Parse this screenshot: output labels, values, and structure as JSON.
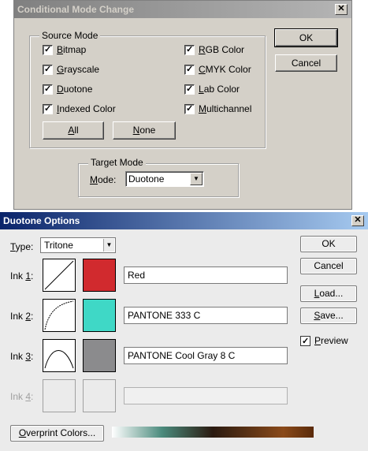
{
  "dialog1": {
    "title": "Conditional Mode Change",
    "close_glyph": "✕",
    "source_mode": {
      "label": "Source Mode",
      "left": [
        {
          "pre": "",
          "ul": "B",
          "post": "itmap",
          "checked": true
        },
        {
          "pre": "",
          "ul": "G",
          "post": "rayscale",
          "checked": true
        },
        {
          "pre": "",
          "ul": "D",
          "post": "uotone",
          "checked": true
        },
        {
          "pre": "",
          "ul": "I",
          "post": "ndexed Color",
          "checked": true
        }
      ],
      "right": [
        {
          "pre": "",
          "ul": "R",
          "post": "GB Color",
          "checked": true
        },
        {
          "pre": "",
          "ul": "C",
          "post": "MYK Color",
          "checked": true
        },
        {
          "pre": "",
          "ul": "L",
          "post": "ab Color",
          "checked": true
        },
        {
          "pre": "",
          "ul": "M",
          "post": "ultichannel",
          "checked": true
        }
      ],
      "all_pre": "",
      "all_ul": "A",
      "all_post": "ll",
      "none_pre": "",
      "none_ul": "N",
      "none_post": "one"
    },
    "target_mode": {
      "label": "Target Mode",
      "mode_pre": "",
      "mode_ul": "M",
      "mode_post": "ode:",
      "mode_value": "Duotone"
    },
    "ok_label": "OK",
    "cancel_label": "Cancel"
  },
  "dialog2": {
    "title": "Duotone Options",
    "close_glyph": "✕",
    "type_pre": "",
    "type_ul": "T",
    "type_post": "ype:",
    "type_value": "Tritone",
    "inks": [
      {
        "pre": "Ink ",
        "ul": "1",
        "post": ":",
        "name": "Red",
        "color": "#d12a2e",
        "curve": "linear",
        "enabled": true
      },
      {
        "pre": "Ink ",
        "ul": "2",
        "post": ":",
        "name": "PANTONE 333 C",
        "color": "#3fd8c6",
        "curve": "concave",
        "enabled": true
      },
      {
        "pre": "Ink ",
        "ul": "3",
        "post": ":",
        "name": "PANTONE Cool Gray 8 C",
        "color": "#8b8b8d",
        "curve": "bell",
        "enabled": true
      },
      {
        "pre": "Ink ",
        "ul": "4",
        "post": ":",
        "name": "",
        "color": "#ebebeb",
        "curve": "none",
        "enabled": false
      }
    ],
    "ok_label": "OK",
    "cancel_label": "Cancel",
    "load_pre": "",
    "load_ul": "L",
    "load_post": "oad...",
    "save_pre": "",
    "save_ul": "S",
    "save_post": "ave...",
    "preview_pre": "",
    "preview_ul": "P",
    "preview_post": "review",
    "preview_checked": true,
    "overprint_pre": "",
    "overprint_ul": "O",
    "overprint_post": "verprint Colors...",
    "gradient_colors": [
      "#ffffff",
      "#4a8a7c",
      "#2a1a10",
      "#8a4a1a",
      "#5a2a0a"
    ]
  }
}
